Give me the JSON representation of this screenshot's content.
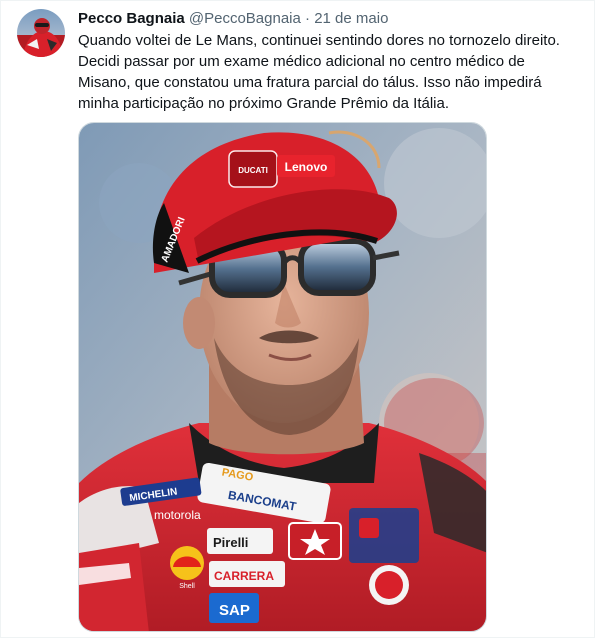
{
  "tweet": {
    "author": {
      "display_name": "Pecco Bagnaia",
      "handle": "@PeccoBagnaia"
    },
    "separator": "·",
    "date": "21 de maio",
    "text_lines": [
      "Quando voltei de Le Mans, continuei sentindo dores no tornozelo direito.",
      "Decidi passar por um exame médico adicional no centro médico de",
      "Misano, que constatou uma fratura parcial do tálus. Isso não impedirá",
      "minha participação no próximo Grande Prêmio da Itália."
    ],
    "media": {
      "cap_logos": [
        "DUCATI",
        "Lenovo",
        "AMADORI"
      ],
      "suit_logos": [
        "PAGO",
        "BANCOMAT",
        "MICHELIN",
        "motorola",
        "Pirelli",
        "CARRERA",
        "SAP",
        "Shell"
      ]
    }
  },
  "colors": {
    "text_primary": "#0f1419",
    "text_secondary": "#536471",
    "border": "#cfd9de",
    "ducati_red": "#d8202a"
  }
}
